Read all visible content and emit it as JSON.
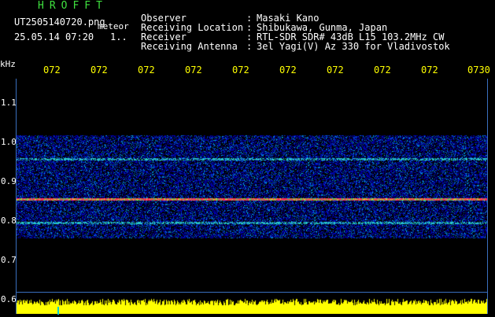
{
  "header": {
    "title": "HROFFT",
    "filename": "UT2505140720.png",
    "meteor_label": "meteor",
    "datetime": "25.05.14 07:20",
    "page_indicator": "1..",
    "info": [
      {
        "key": "Observer",
        "value": "Masaki Kano"
      },
      {
        "key": "Receiving Location",
        "value": "Shibukawa, Gunma, Japan"
      },
      {
        "key": "Receiver",
        "value": "RTL-SDR SDR# 43dB L15 103.2MHz CW"
      },
      {
        "key": "Receiving Antenna",
        "value": "3el Yagi(V) Az 330 for Vladivostok"
      }
    ]
  },
  "chart_data": {
    "type": "heatmap",
    "yunit": "kHz",
    "y_ticks": [
      "1.1",
      "1.0",
      "0.9",
      "0.8",
      "0.7",
      "0.6"
    ],
    "x_ticks": [
      "072",
      "072",
      "072",
      "072",
      "072",
      "072",
      "072",
      "072",
      "072",
      "0730"
    ],
    "ylim": [
      0.6,
      1.15
    ],
    "signal_band_khz": [
      0.76,
      1.03
    ],
    "bright_lines_khz": [
      0.968,
      0.863,
      0.8
    ],
    "strongest_line_khz": 0.863
  },
  "colors": {
    "background": "#000000",
    "title": "#3fe03f",
    "xticks": "#ffff00",
    "border": "#3a6fbf",
    "noise_bar": "#ffff00"
  }
}
